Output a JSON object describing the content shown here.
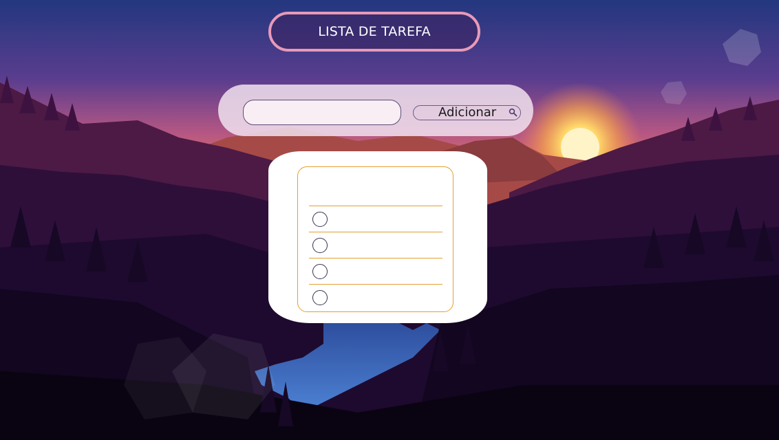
{
  "header": {
    "title": "LISTA DE TAREFA"
  },
  "form": {
    "input_value": "",
    "input_placeholder": "",
    "add_label": "Adicionar"
  },
  "tasks": [
    {
      "text": "",
      "done": false
    },
    {
      "text": "",
      "done": false
    },
    {
      "text": "",
      "done": false
    },
    {
      "text": "",
      "done": false
    }
  ],
  "icons": {
    "add": "search-icon",
    "task_check": "circle-checkbox-icon"
  },
  "colors": {
    "title_border": "#e69ab8",
    "list_accent": "#e3a02e",
    "panel_bg": "#f0e1ee",
    "sky_top": "#2a3a8a",
    "sky_sunset": "#e2706a",
    "sun": "#fff4c8"
  }
}
